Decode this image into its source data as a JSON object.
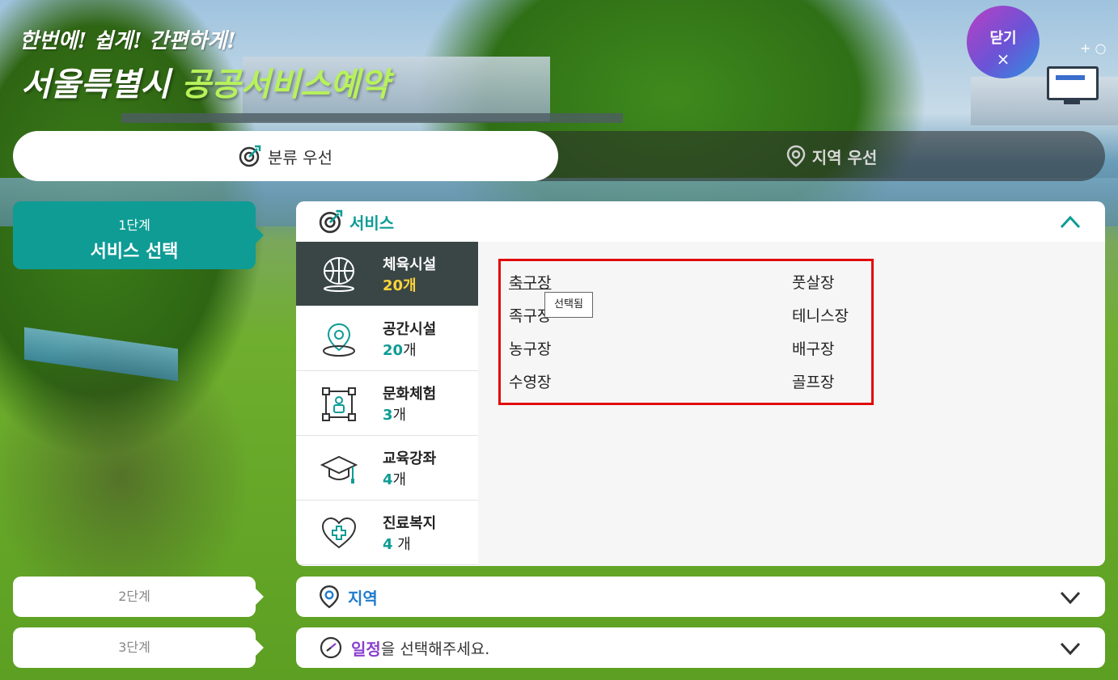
{
  "header": {
    "tagline": "한번에! 쉽게! 간편하게!",
    "brand_main": "서울특별시 ",
    "brand_highlight": "공공서비스예약",
    "close_label": "닫기",
    "close_symbol": "×"
  },
  "tabs": {
    "category": "분류 우선",
    "region": "지역 우선"
  },
  "steps": {
    "step1_number": "1단계",
    "step1_title": "서비스 선택",
    "step2": "2단계",
    "step3": "3단계"
  },
  "service_panel": {
    "title": "서비스",
    "categories": [
      {
        "name": "체육시설",
        "count": "20개",
        "icon": "basketball-icon",
        "active": true
      },
      {
        "name": "공간시설",
        "count": "20",
        "unit": "개",
        "icon": "location-pin-icon"
      },
      {
        "name": "문화체험",
        "count": "3",
        "unit": "개",
        "icon": "person-frame-icon"
      },
      {
        "name": "교육강좌",
        "count": "4",
        "unit": "개",
        "icon": "graduation-cap-icon"
      },
      {
        "name": "진료복지",
        "count": "4",
        "unit": " 개",
        "icon": "heart-plus-icon"
      }
    ],
    "items_left": [
      "축구장",
      "족구장",
      "농구장",
      "수영장"
    ],
    "items_right": [
      "풋살장",
      "테니스장",
      "배구장",
      "골프장"
    ],
    "tooltip": "선택됨"
  },
  "region_panel": {
    "title": "지역"
  },
  "schedule_panel": {
    "title_highlight": "일정",
    "title_rest": "을 선택해주세요."
  },
  "colors": {
    "teal": "#0e9c95",
    "blue": "#1f7ccc",
    "purple": "#8a3fcf",
    "highlight_red": "#e20a0a",
    "yellow": "#ffd43b"
  }
}
